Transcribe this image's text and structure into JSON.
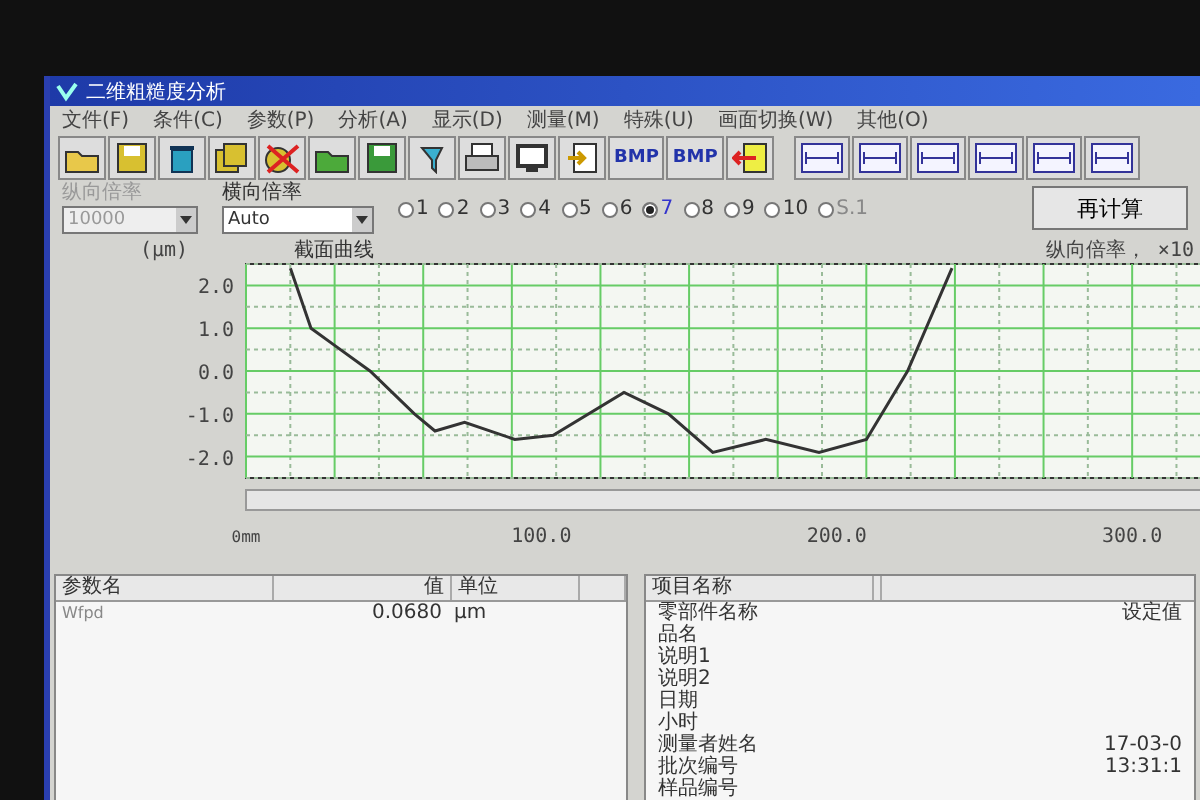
{
  "window": {
    "title": "二维粗糙度分析"
  },
  "menu": [
    "文件(F)",
    "条件(C)",
    "参数(P)",
    "分析(A)",
    "显示(D)",
    "测量(M)",
    "特殊(U)",
    "画面切换(W)",
    "其他(O)"
  ],
  "toolbar": {
    "bmp_labels": [
      "BMP",
      "BMP"
    ]
  },
  "vertical_magnification": {
    "label": "纵向倍率",
    "value": "10000",
    "disabled": true
  },
  "horizontal_magnification": {
    "label": "横向倍率",
    "value": "Auto",
    "disabled": false
  },
  "radios": [
    {
      "label": "1",
      "selected": false,
      "disabled": false
    },
    {
      "label": "2",
      "selected": false,
      "disabled": false
    },
    {
      "label": "3",
      "selected": false,
      "disabled": false
    },
    {
      "label": "4",
      "selected": false,
      "disabled": false
    },
    {
      "label": "5",
      "selected": false,
      "disabled": false
    },
    {
      "label": "6",
      "selected": false,
      "disabled": false
    },
    {
      "label": "7",
      "selected": true,
      "disabled": false
    },
    {
      "label": "8",
      "selected": false,
      "disabled": false
    },
    {
      "label": "9",
      "selected": false,
      "disabled": false
    },
    {
      "label": "10",
      "selected": false,
      "disabled": false
    },
    {
      "label": "S.1",
      "selected": false,
      "disabled": true
    }
  ],
  "recalculate_button": "再计算",
  "chart": {
    "unit": "(μm)",
    "magnification_note": "纵向倍率， ×10",
    "chart_data": {
      "type": "line",
      "title": "截面曲线",
      "x": [
        15,
        22,
        30,
        42,
        57,
        64,
        74,
        91,
        104,
        128,
        143,
        158,
        176,
        194,
        210,
        224,
        239
      ],
      "series": [
        {
          "color": "#333333",
          "values": [
            2.4,
            1.0,
            0.6,
            0.0,
            -1.0,
            -1.4,
            -1.2,
            -1.6,
            -1.5,
            -0.5,
            -1.0,
            -1.9,
            -1.6,
            -1.9,
            -1.6,
            0.0,
            2.4
          ]
        }
      ],
      "grid": true,
      "xlim": [
        0,
        325
      ],
      "ylim": [
        -2.5,
        2.5
      ],
      "xticks": [
        {
          "value": 0,
          "label": "0mm"
        },
        {
          "value": 100,
          "label": "100.0"
        },
        {
          "value": 200,
          "label": "200.0"
        },
        {
          "value": 300,
          "label": "300.0"
        }
      ],
      "yticks": [
        {
          "value": 2,
          "label": "2.0"
        },
        {
          "value": 1,
          "label": "1.0"
        },
        {
          "value": 0,
          "label": "0.0"
        },
        {
          "value": -1,
          "label": "-1.0"
        },
        {
          "value": -2,
          "label": "-2.0"
        }
      ]
    }
  },
  "parameter_table": {
    "columns": [
      "参数名",
      "值",
      "单位"
    ],
    "rows": [
      {
        "name": "Wfpd",
        "value": "0.0680",
        "unit": "μm"
      }
    ]
  },
  "item_table": {
    "column": "项目名称",
    "rows": [
      {
        "name": "零部件名称",
        "value": "设定值"
      },
      {
        "name": "品名"
      },
      {
        "name": "说明1"
      },
      {
        "name": "说明2"
      },
      {
        "name": "日期"
      },
      {
        "name": "小时"
      },
      {
        "name": "测量者姓名",
        "value": "17-03-0"
      },
      {
        "name": "批次编号",
        "value": "13:31:1"
      },
      {
        "name": "样品编号"
      }
    ]
  }
}
